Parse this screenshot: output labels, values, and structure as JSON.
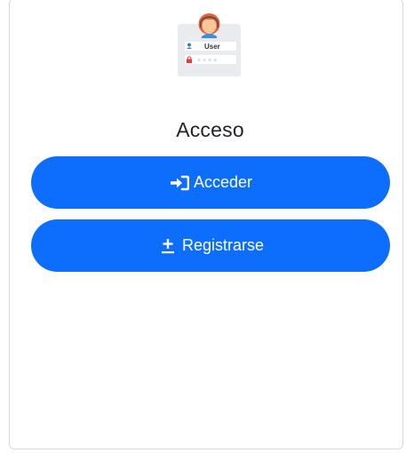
{
  "logo": {
    "user_text": "User",
    "password_mask": "× × × ×",
    "icon": "user-login-illustration"
  },
  "title": "Acceso",
  "buttons": {
    "login": {
      "label": "Acceder",
      "icon": "sign-in-icon"
    },
    "register": {
      "label": "Registrarse",
      "icon": "plus-minus-icon"
    }
  },
  "colors": {
    "primary": "#0d6efd",
    "button_text": "#ffffff",
    "title_text": "#212529",
    "card_border": "#d9dbde"
  }
}
